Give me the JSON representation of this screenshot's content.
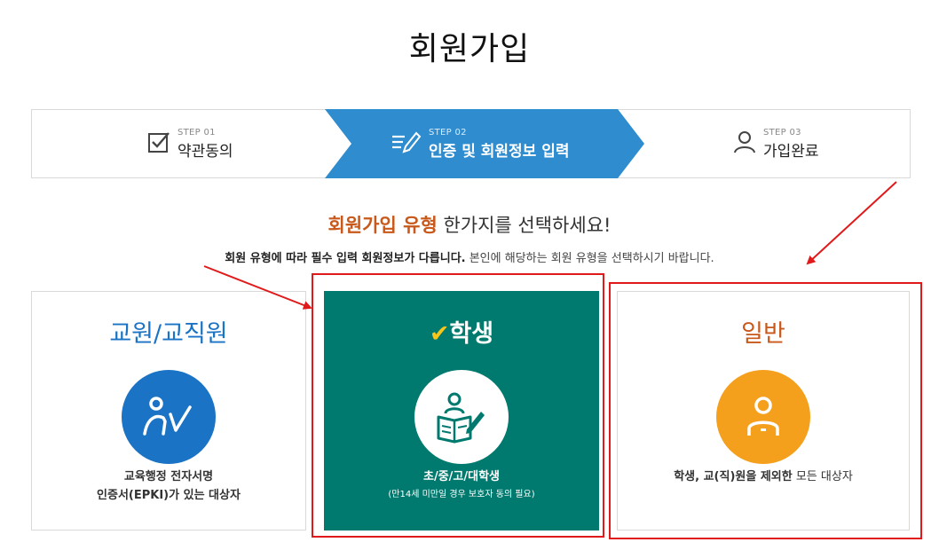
{
  "page": {
    "title": "회원가입"
  },
  "steps": [
    {
      "no": "STEP 01",
      "label": "약관동의",
      "icon": "checkbox-icon"
    },
    {
      "no": "STEP 02",
      "label": "인증 및 회원정보 입력",
      "icon": "form-edit-icon",
      "active": true
    },
    {
      "no": "STEP 03",
      "label": "가입완료",
      "icon": "user-icon"
    }
  ],
  "subheading": {
    "highlight": "회원가입 유형",
    "rest": " 한가지를 선택하세요!"
  },
  "description": {
    "bold": "회원 유형에 따라 필수 입력 회원정보가 다릅니다.",
    "rest": " 본인에 해당하는 회원 유형을 선택하시기 바랍니다."
  },
  "cards": {
    "teacher": {
      "title": "교원/교직원",
      "line1": "교육행정 전자서명",
      "line2": "인증서(EPKI)가 있는 대상자",
      "icon": "teacher-icon"
    },
    "student": {
      "check": "✔",
      "title": "학생",
      "line1": "초/중/고/대학생",
      "note": "(만14세 미만일 경우 보호자 동의 필요)",
      "icon": "student-reading-icon"
    },
    "general": {
      "title": "일반",
      "bold": "학생, 교(직)원을 제외한",
      "rest": " 모든 대상자",
      "icon": "person-icon"
    }
  },
  "colors": {
    "accent_blue": "#2f8ccf",
    "teacher_blue": "#1a73c4",
    "student_green": "#007a6e",
    "general_orange": "#f5a01d",
    "highlight_orange": "#c9581b",
    "annotation_red": "#e01a1a"
  }
}
